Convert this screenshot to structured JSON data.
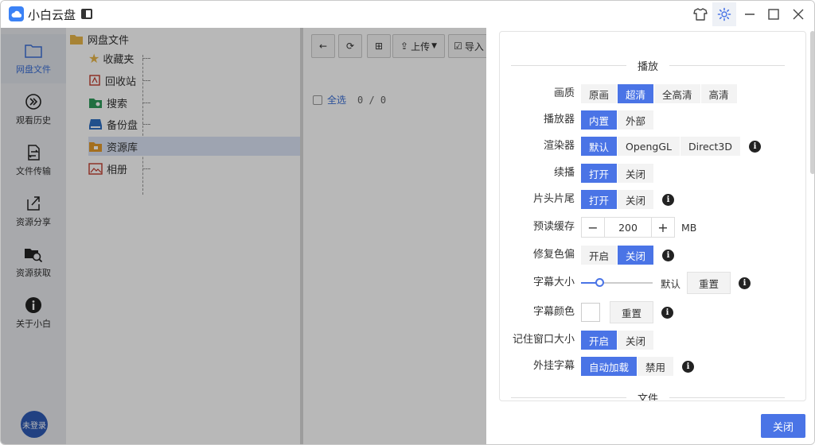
{
  "app": {
    "title": "小白云盘"
  },
  "colors": {
    "accent": "#4a74e6",
    "avatar": "#2f5bb5"
  },
  "rail": {
    "items": [
      {
        "label": "网盘文件",
        "icon": "folder-icon"
      },
      {
        "label": "观看历史",
        "icon": "play-circle-icon"
      },
      {
        "label": "文件传输",
        "icon": "transfer-icon"
      },
      {
        "label": "资源分享",
        "icon": "share-icon"
      },
      {
        "label": "资源获取",
        "icon": "folder-search-icon"
      },
      {
        "label": "关于小白",
        "icon": "info-icon"
      }
    ],
    "avatar_label": "未登录"
  },
  "tree": {
    "root": "网盘文件",
    "children": [
      "收藏夹",
      "回收站",
      "搜索",
      "备份盘",
      "资源库",
      "相册"
    ]
  },
  "toolbar": {
    "upload_label": "上传",
    "import_label": "导入"
  },
  "list": {
    "select_all": "全选",
    "count": "0 / 0"
  },
  "settings": {
    "section_play": "播放",
    "section_file": "文件",
    "quality": {
      "label": "画质",
      "options": [
        "原画",
        "超清",
        "全高清",
        "高清"
      ],
      "selected": 1
    },
    "player": {
      "label": "播放器",
      "options": [
        "内置",
        "外部"
      ],
      "selected": 0
    },
    "renderer": {
      "label": "渲染器",
      "options": [
        "默认",
        "OpengGL",
        "Direct3D"
      ],
      "selected": 0
    },
    "resume": {
      "label": "续播",
      "options": [
        "打开",
        "关闭"
      ],
      "selected": 0
    },
    "skip_intro": {
      "label": "片头片尾",
      "options": [
        "打开",
        "关闭"
      ],
      "selected": 0
    },
    "preload": {
      "label": "预读缓存",
      "value": "200",
      "unit": "MB"
    },
    "color_fix": {
      "label": "修复色偏",
      "options": [
        "开启",
        "关闭"
      ],
      "selected": 1
    },
    "subtitle_size": {
      "label": "字幕大小",
      "level": 0.25,
      "value": "默认",
      "reset": "重置"
    },
    "subtitle_color": {
      "label": "字幕颜色",
      "color": "#ffffff",
      "reset": "重置"
    },
    "remember_window": {
      "label": "记住窗口大小",
      "options": [
        "开启",
        "关闭"
      ],
      "selected": 0
    },
    "external_subs": {
      "label": "外挂字幕",
      "options": [
        "自动加载",
        "禁用"
      ],
      "selected": 0
    },
    "close_label": "关闭"
  }
}
